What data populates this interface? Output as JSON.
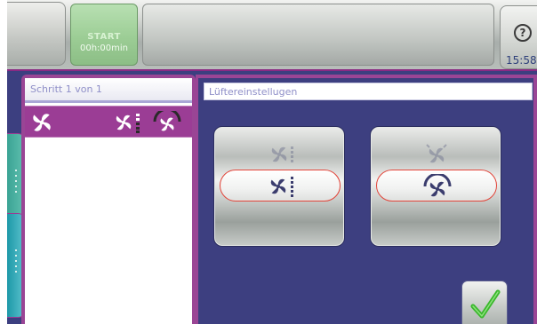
{
  "colors": {
    "accent": "#9a4595",
    "background": "#3c3f80",
    "start_green": "#9ccd95",
    "selection_ring": "#e2453a",
    "confirm_green": "#38b82a"
  },
  "header": {
    "start_label": "START",
    "start_time": "00h:00min",
    "help_symbol": "?",
    "clock": "15:58"
  },
  "steps": {
    "header": "Schritt  1  von  1",
    "rows": [
      {
        "icons": [
          "fan-icon",
          "fan-speed-icon",
          "fan-direction-icon"
        ]
      }
    ]
  },
  "settings": {
    "title": "Lüftereinstellugen",
    "options": [
      {
        "name": "fan-speed",
        "icon": "fan-speed-icon",
        "selected": true
      },
      {
        "name": "fan-direction",
        "icon": "fan-direction-icon",
        "selected": true
      }
    ],
    "confirm_icon": "checkmark-icon"
  }
}
